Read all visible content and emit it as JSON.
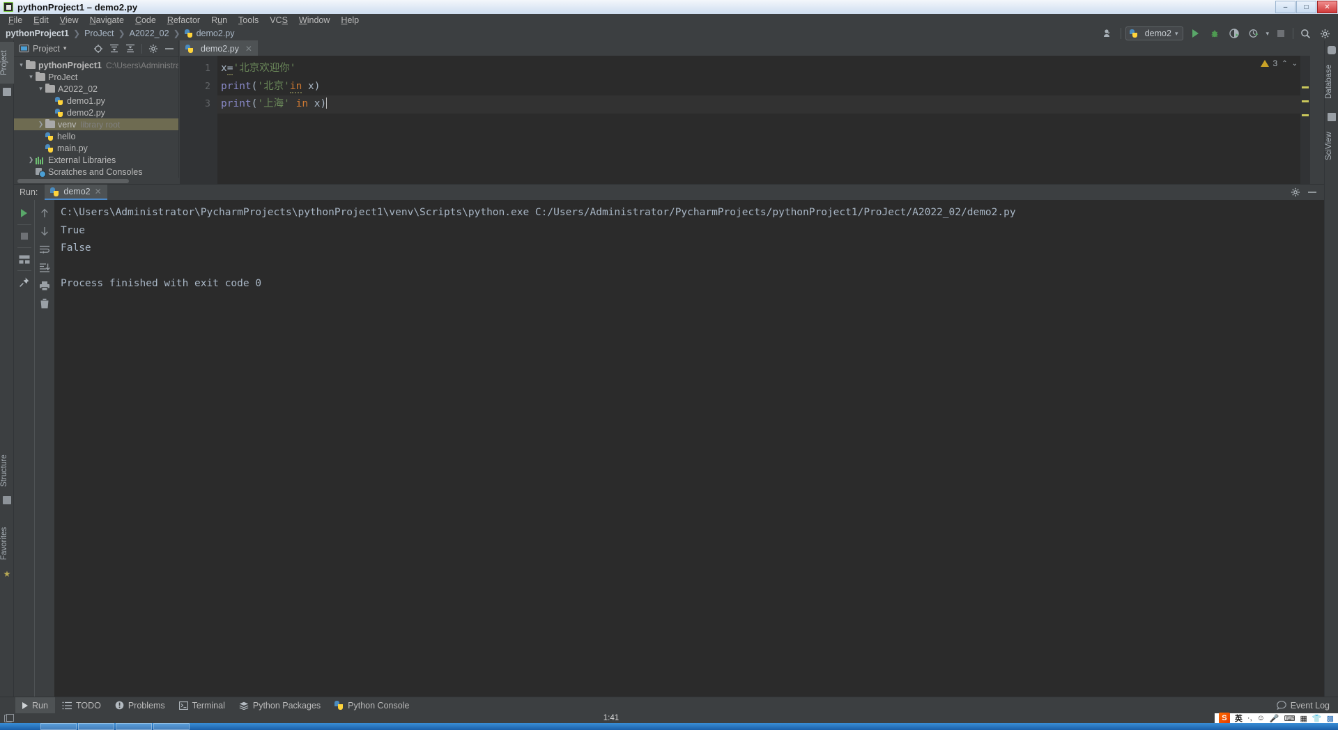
{
  "window": {
    "title": "pythonProject1 – demo2.py",
    "icon": "pycharm-icon",
    "minimize": "–",
    "maximize": "□",
    "close": "✕"
  },
  "menubar": {
    "items": [
      {
        "label": "File",
        "mnemonic": "F"
      },
      {
        "label": "Edit",
        "mnemonic": "E"
      },
      {
        "label": "View",
        "mnemonic": "V"
      },
      {
        "label": "Navigate",
        "mnemonic": "N"
      },
      {
        "label": "Code",
        "mnemonic": "C"
      },
      {
        "label": "Refactor",
        "mnemonic": "R"
      },
      {
        "label": "Run",
        "mnemonic": "u"
      },
      {
        "label": "Tools",
        "mnemonic": "T"
      },
      {
        "label": "VCS",
        "mnemonic": "S"
      },
      {
        "label": "Window",
        "mnemonic": "W"
      },
      {
        "label": "Help",
        "mnemonic": "H"
      }
    ]
  },
  "navbar": {
    "crumbs": [
      "pythonProject1",
      "ProJect",
      "A2022_02",
      "demo2.py"
    ],
    "separator": "❯",
    "run_config": "demo2",
    "icons": [
      "people-icon",
      "run-icon",
      "debug-icon",
      "coverage-icon",
      "profile-icon",
      "stop-icon",
      "search-icon",
      "gear-icon"
    ]
  },
  "left_strip": {
    "project_label": "Project",
    "structure_label": "Structure",
    "favorites_label": "Favorites"
  },
  "right_strip": {
    "database_label": "Database",
    "sciview_label": "SciView"
  },
  "project_panel": {
    "title": "Project",
    "header_icons": [
      "target-icon",
      "collapse-all-icon",
      "expand-all-icon",
      "gear-icon",
      "hide-icon"
    ],
    "tree": [
      {
        "indent": 0,
        "chevron": "▾",
        "icon": "folder-icon",
        "name": "pythonProject1",
        "bold": true,
        "hint": "C:\\Users\\Administrator\\Py",
        "selected": false
      },
      {
        "indent": 1,
        "chevron": "▾",
        "icon": "folder-icon",
        "name": "ProJect",
        "bold": false,
        "hint": "",
        "selected": false
      },
      {
        "indent": 2,
        "chevron": "▾",
        "icon": "folder-icon",
        "name": "A2022_02",
        "bold": false,
        "hint": "",
        "selected": false
      },
      {
        "indent": 3,
        "chevron": "",
        "icon": "python-file-icon",
        "name": "demo1.py",
        "bold": false,
        "hint": "",
        "selected": false
      },
      {
        "indent": 3,
        "chevron": "",
        "icon": "python-file-icon",
        "name": "demo2.py",
        "bold": false,
        "hint": "",
        "selected": false
      },
      {
        "indent": 1,
        "chevron": "❯",
        "icon": "folder-icon",
        "name": "venv",
        "bold": false,
        "hint": "library root",
        "selected": true
      },
      {
        "indent": 2,
        "chevron": "",
        "icon": "python-file-icon",
        "name": "hello",
        "bold": false,
        "hint": "",
        "selected": false
      },
      {
        "indent": 2,
        "chevron": "",
        "icon": "python-file-icon",
        "name": "main.py",
        "bold": false,
        "hint": "",
        "selected": false
      },
      {
        "indent": 0,
        "chevron": "❯",
        "icon": "libraries-icon",
        "name": "External Libraries",
        "bold": false,
        "hint": "",
        "selected": false
      },
      {
        "indent": 0,
        "chevron": "",
        "icon": "scratches-icon",
        "name": "Scratches and Consoles",
        "bold": false,
        "hint": "",
        "selected": false
      }
    ]
  },
  "editor": {
    "tab": {
      "label": "demo2.py",
      "icon": "python-file-icon",
      "close": "✕"
    },
    "line_numbers": [
      "1",
      "2",
      "3"
    ],
    "lines": [
      {
        "n": 1,
        "tokens": [
          {
            "t": "x",
            "c": "plain"
          },
          {
            "t": "=",
            "c": "plain-squiggle"
          },
          {
            "t": "'北京欢迎你'",
            "c": "string"
          }
        ]
      },
      {
        "n": 2,
        "tokens": [
          {
            "t": "print",
            "c": "func"
          },
          {
            "t": "(",
            "c": "plain"
          },
          {
            "t": "'北京'",
            "c": "string"
          },
          {
            "t": "in",
            "c": "keyword-squiggle"
          },
          {
            "t": " x)",
            "c": "plain"
          }
        ]
      },
      {
        "n": 3,
        "tokens": [
          {
            "t": "print",
            "c": "func"
          },
          {
            "t": "(",
            "c": "plain"
          },
          {
            "t": "'上海'",
            "c": "string"
          },
          {
            "t": " ",
            "c": "plain"
          },
          {
            "t": "in",
            "c": "keyword"
          },
          {
            "t": " x)",
            "c": "plain"
          }
        ]
      }
    ],
    "inspection_count": "3",
    "inspection_icon": "warning-triangle-icon",
    "up_icon": "chevron-up-icon",
    "down_icon": "chevron-down-icon"
  },
  "run_panel": {
    "label": "Run:",
    "tab": "demo2",
    "tab_icon": "python-icon",
    "tab_close": "✕",
    "settings_icon": "gear-icon",
    "hide_icon": "minimize-icon",
    "toolbar_left": [
      "rerun-icon",
      "stop-icon",
      "layout-icon",
      "pin-icon"
    ],
    "toolbar_right": [
      "up-icon",
      "down-icon",
      "soft-wrap-icon",
      "scroll-to-end-icon",
      "print-icon",
      "trash-icon"
    ],
    "console_lines": [
      "C:\\Users\\Administrator\\PycharmProjects\\pythonProject1\\venv\\Scripts\\python.exe C:/Users/Administrator/PycharmProjects/pythonProject1/ProJect/A2022_02/demo2.py",
      "True",
      "False",
      "",
      "Process finished with exit code 0"
    ],
    "caret_after": "C:\\Users\\Administrator\\PycharmProjects\\p"
  },
  "bottom_bar": {
    "items": [
      {
        "label": "Run",
        "icon": "run-triangle-icon",
        "active": true
      },
      {
        "label": "TODO",
        "icon": "todo-list-icon",
        "active": false
      },
      {
        "label": "Problems",
        "icon": "problems-icon",
        "active": false
      },
      {
        "label": "Terminal",
        "icon": "terminal-icon",
        "active": false
      },
      {
        "label": "Python Packages",
        "icon": "packages-icon",
        "active": false
      },
      {
        "label": "Python Console",
        "icon": "python-icon",
        "active": false
      }
    ],
    "event_log": "Event Log",
    "event_log_icon": "balloon-icon"
  },
  "status_bar": {
    "layout_icon": "layout-square-icon",
    "clock": "1:41",
    "tray": [
      "sogou-logo",
      "英",
      "·,",
      "smiley-icon",
      "mic-icon",
      "keyboard-icon",
      "toolbox-icon",
      "shirt-icon",
      "apps-icon"
    ]
  },
  "colors": {
    "bg": "#3c3f41",
    "editor_bg": "#2b2b2b",
    "accent_blue": "#4a88c7",
    "selection": "#6e6b51",
    "string_green": "#6a8759",
    "keyword_orange": "#cc7832",
    "func_violet": "#8888c6",
    "text": "#bbbbbb"
  }
}
